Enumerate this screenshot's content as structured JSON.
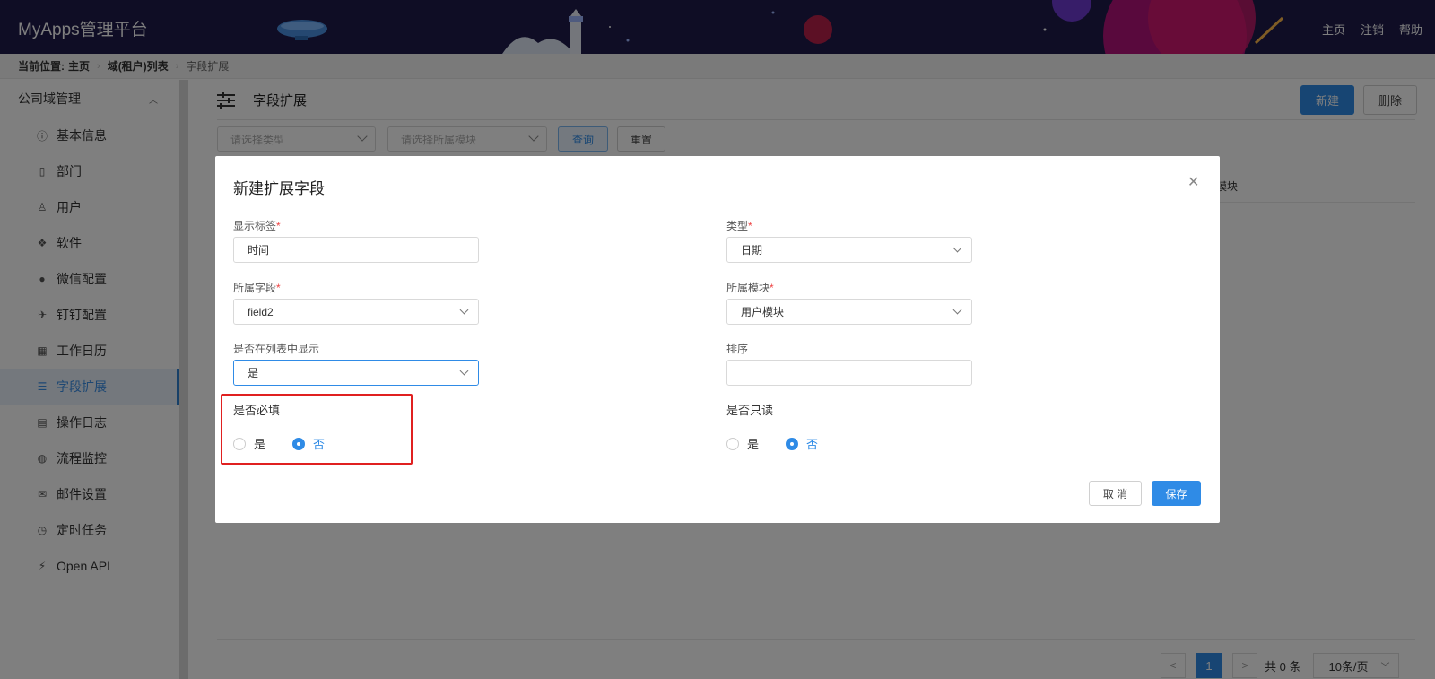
{
  "header": {
    "brand": "MyApps管理平台",
    "nav": [
      "主页",
      "注销",
      "帮助"
    ]
  },
  "breadcrumb": {
    "label": "当前位置:",
    "items": [
      "主页",
      "域(租户)列表",
      "字段扩展"
    ]
  },
  "sidebar": {
    "group": "公司域管理",
    "items": [
      {
        "label": "基本信息",
        "icon": "info-icon"
      },
      {
        "label": "部门",
        "icon": "building-icon"
      },
      {
        "label": "用户",
        "icon": "user-icon"
      },
      {
        "label": "软件",
        "icon": "cubes-icon"
      },
      {
        "label": "微信配置",
        "icon": "wechat-icon"
      },
      {
        "label": "钉钉配置",
        "icon": "plane-icon"
      },
      {
        "label": "工作日历",
        "icon": "calendar-icon"
      },
      {
        "label": "字段扩展",
        "icon": "sliders-icon",
        "active": true
      },
      {
        "label": "操作日志",
        "icon": "log-icon"
      },
      {
        "label": "流程监控",
        "icon": "dashboard-icon"
      },
      {
        "label": "邮件设置",
        "icon": "mail-icon"
      },
      {
        "label": "定时任务",
        "icon": "clock-icon"
      },
      {
        "label": "Open API",
        "icon": "plug-icon"
      }
    ]
  },
  "main": {
    "title": "字段扩展",
    "new_button": "新建",
    "delete_button": "删除",
    "filter_type_placeholder": "请选择类型",
    "filter_module_placeholder": "请选择所属模块",
    "query_button": "查询",
    "reset_button": "重置",
    "column_header_partial": "模块",
    "pager": {
      "prev": "<",
      "current": "1",
      "next": ">",
      "total": "共 0 条",
      "page_size": "10条/页"
    }
  },
  "dialog": {
    "title": "新建扩展字段",
    "fields": {
      "display_label": {
        "label": "显示标签",
        "value": "时间",
        "required": "*"
      },
      "type": {
        "label": "类型",
        "value": "日期",
        "required": "*"
      },
      "field": {
        "label": "所属字段",
        "value": "field2",
        "required": "*"
      },
      "module": {
        "label": "所属模块",
        "value": "用户模块",
        "required": "*"
      },
      "show_in_list": {
        "label": "是否在列表中显示",
        "value": "是"
      },
      "sort": {
        "label": "排序",
        "value": ""
      },
      "required_flag": {
        "label": "是否必填",
        "options": [
          "是",
          "否"
        ],
        "selected": "否"
      },
      "readonly_flag": {
        "label": "是否只读",
        "options": [
          "是",
          "否"
        ],
        "selected": "否"
      }
    },
    "cancel_button": "取 消",
    "save_button": "保存"
  },
  "colors": {
    "header_bg": "#1e1b4b",
    "primary": "#2f8be6",
    "highlight": "#e02020"
  }
}
